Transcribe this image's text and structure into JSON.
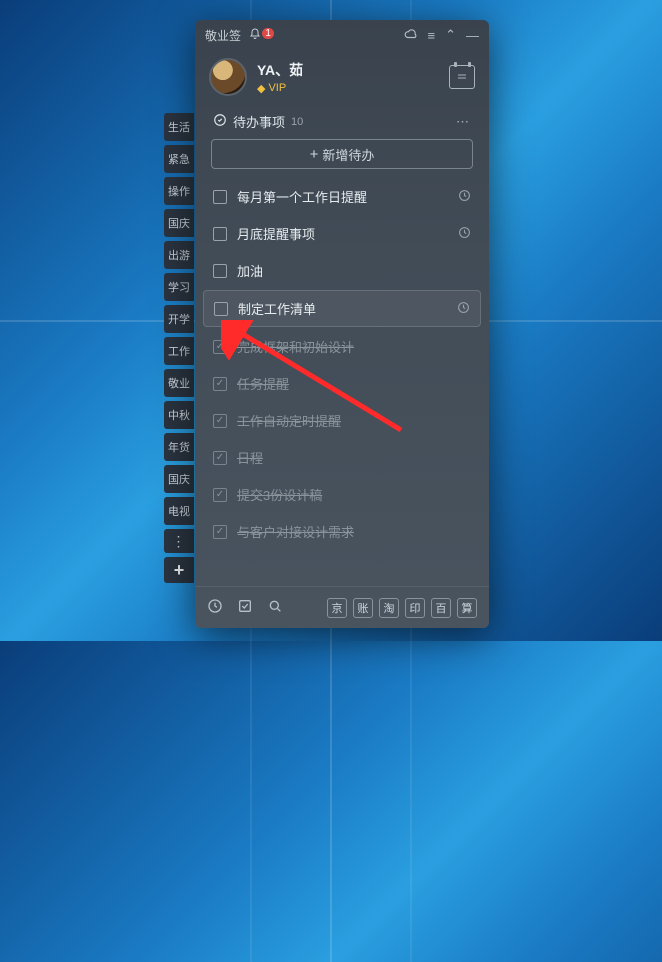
{
  "titlebar": {
    "app_name": "敬业签",
    "notif_count": "1"
  },
  "profile": {
    "username": "YA、茹",
    "vip_label": "VIP"
  },
  "section": {
    "title": "待办事项",
    "count": "10"
  },
  "add_button": {
    "label": "新增待办"
  },
  "sidebar": {
    "items": [
      "生活",
      "紧急",
      "操作",
      "国庆",
      "出游",
      "学习",
      "开学",
      "工作",
      "敬业",
      "中秋",
      "年货",
      "国庆",
      "电视"
    ]
  },
  "todos": [
    {
      "text": "每月第一个工作日提醒",
      "done": false,
      "clock": true,
      "hl": false
    },
    {
      "text": "月底提醒事项",
      "done": false,
      "clock": true,
      "hl": false
    },
    {
      "text": "加油",
      "done": false,
      "clock": false,
      "hl": false
    },
    {
      "text": "制定工作清单",
      "done": false,
      "clock": true,
      "hl": true
    },
    {
      "text": "完成框架和初始设计",
      "done": true,
      "clock": false,
      "hl": false
    },
    {
      "text": "任务提醒",
      "done": true,
      "clock": false,
      "hl": false
    },
    {
      "text": "工作自动定时提醒",
      "done": true,
      "clock": false,
      "hl": false
    },
    {
      "text": "日程",
      "done": true,
      "clock": false,
      "hl": false
    },
    {
      "text": "提交3份设计稿",
      "done": true,
      "clock": false,
      "hl": false
    },
    {
      "text": "与客户对接设计需求",
      "done": true,
      "clock": false,
      "hl": false
    }
  ],
  "bottom_chips": [
    "京",
    "账",
    "淘",
    "印",
    "百",
    "算"
  ]
}
